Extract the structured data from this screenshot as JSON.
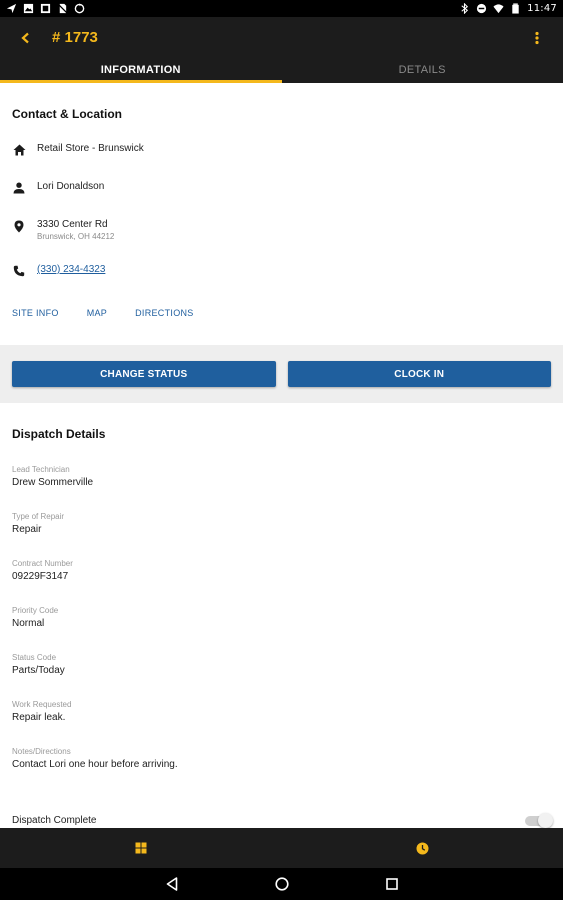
{
  "status_bar": {
    "time": "11:47",
    "icons_left": [
      "navigation-icon",
      "image-icon",
      "gallery-icon",
      "no-sim-icon",
      "sync-icon"
    ],
    "icons_right": [
      "bluetooth-icon",
      "do-not-disturb-icon",
      "wifi-icon",
      "battery-icon"
    ]
  },
  "app_bar": {
    "title": "# 1773",
    "accent_color": "#f4b81c",
    "tabs": [
      {
        "label": "INFORMATION",
        "active": true
      },
      {
        "label": "DETAILS",
        "active": false
      }
    ]
  },
  "contact": {
    "section_title": "Contact & Location",
    "site_name": "Retail Store - Brunswick",
    "contact_name": "Lori Donaldson",
    "address_line1": "3330 Center Rd",
    "address_line2": "Brunswick, OH 44212",
    "phone": "(330) 234-4323",
    "links": [
      "SITE INFO",
      "MAP",
      "DIRECTIONS"
    ]
  },
  "actions": {
    "change_status_label": "CHANGE STATUS",
    "clock_in_label": "CLOCK IN",
    "button_color": "#1f5f9e"
  },
  "dispatch": {
    "section_title": "Dispatch Details",
    "fields": [
      {
        "label": "Lead Technician",
        "value": "Drew Sommerville"
      },
      {
        "label": "Type of Repair",
        "value": "Repair"
      },
      {
        "label": "Contract Number",
        "value": "09229F3147"
      },
      {
        "label": "Priority Code",
        "value": "Normal"
      },
      {
        "label": "Status Code",
        "value": "Parts/Today"
      },
      {
        "label": "Work Requested",
        "value": "Repair leak."
      },
      {
        "label": "Notes/Directions",
        "value": "Contact Lori one hour before arriving."
      }
    ],
    "complete_label": "Dispatch Complete",
    "complete_toggle_on": false
  },
  "bottom_bar": {
    "items": [
      "dashboard-icon",
      "clock-icon"
    ]
  },
  "nav_bar": {
    "items": [
      "back-triangle-icon",
      "home-circle-icon",
      "recents-square-icon"
    ]
  }
}
